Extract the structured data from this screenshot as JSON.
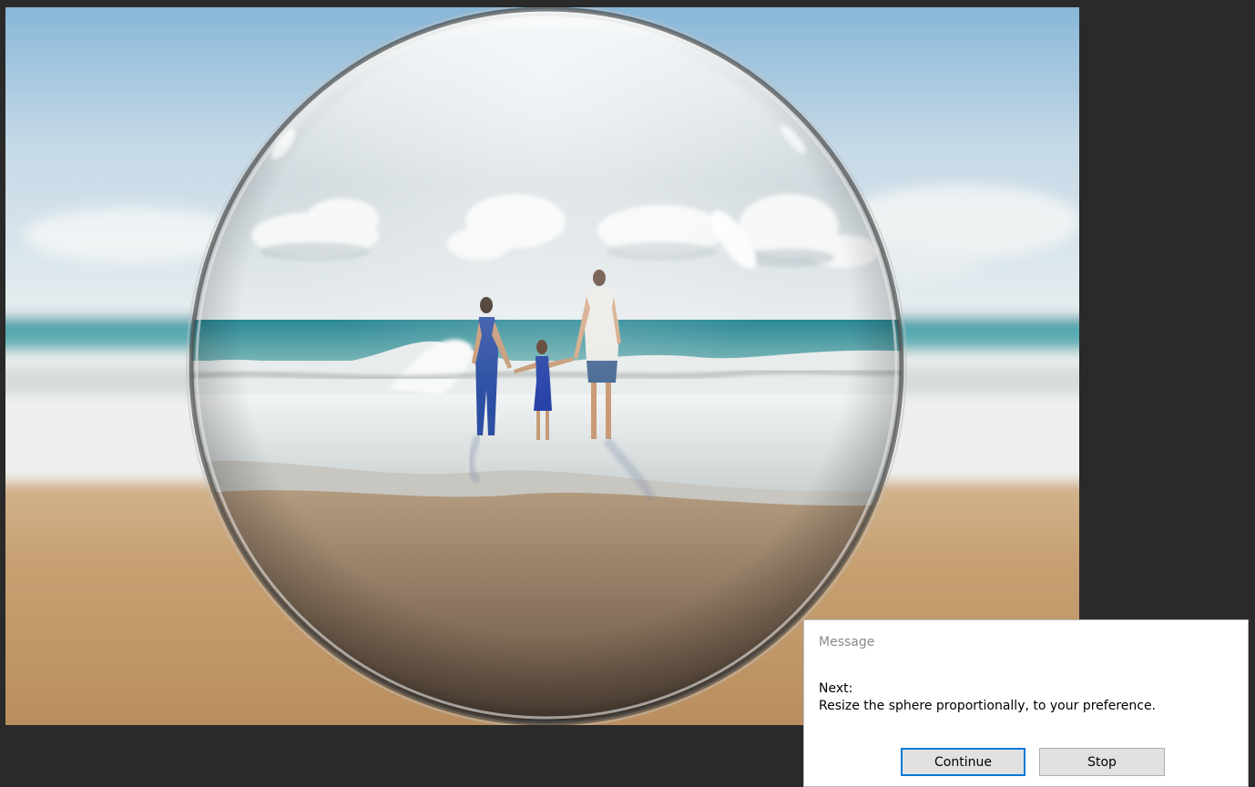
{
  "canvas": {
    "description_colors": {
      "sky_top": "#8ab7d8",
      "sky_bottom": "#e6ecee",
      "sea": "#3e9aa6",
      "surf": "#eef0ef",
      "sand": "#c49a6c",
      "workspace": "#2a2a2a"
    }
  },
  "dialog": {
    "title": "Message",
    "heading": "Next:",
    "message": "Resize the sphere proportionally, to your preference.",
    "continue_label": "Continue",
    "stop_label": "Stop"
  }
}
